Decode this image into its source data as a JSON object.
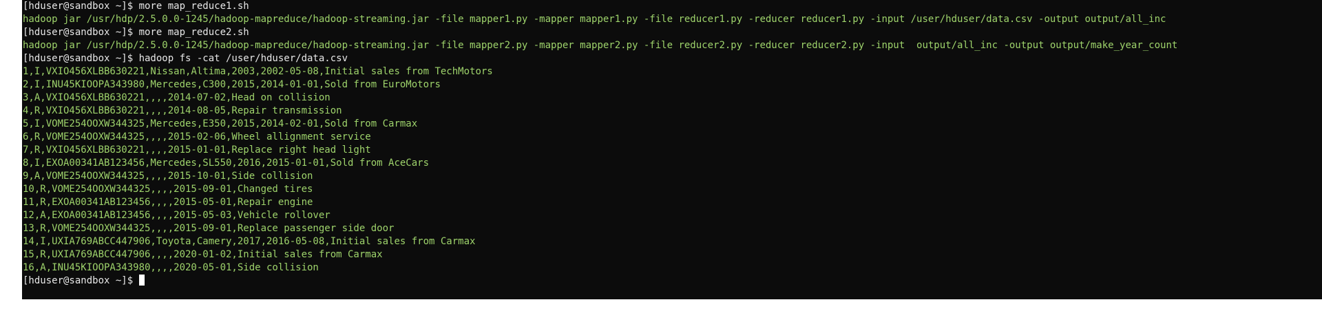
{
  "terminal": {
    "prompt_color": "#e8e8e8",
    "output_color": "#9ed36b",
    "background": "#0c0c0c",
    "lines": [
      {
        "type": "prompt",
        "text": "[hduser@sandbox ~]$ more map_reduce1.sh"
      },
      {
        "type": "output",
        "text": "hadoop jar /usr/hdp/2.5.0.0-1245/hadoop-mapreduce/hadoop-streaming.jar -file mapper1.py -mapper mapper1.py -file reducer1.py -reducer reducer1.py -input /user/hduser/data.csv -output output/all_inc"
      },
      {
        "type": "prompt",
        "text": "[hduser@sandbox ~]$ more map_reduce2.sh"
      },
      {
        "type": "output",
        "text": "hadoop jar /usr/hdp/2.5.0.0-1245/hadoop-mapreduce/hadoop-streaming.jar -file mapper2.py -mapper mapper2.py -file reducer2.py -reducer reducer2.py -input  output/all_inc -output output/make_year_count"
      },
      {
        "type": "prompt",
        "text": "[hduser@sandbox ~]$ hadoop fs -cat /user/hduser/data.csv"
      },
      {
        "type": "output",
        "text": "1,I,VXIO456XLBB630221,Nissan,Altima,2003,2002-05-08,Initial sales from TechMotors"
      },
      {
        "type": "output",
        "text": "2,I,INU45KIOOPA343980,Mercedes,C300,2015,2014-01-01,Sold from EuroMotors"
      },
      {
        "type": "output",
        "text": "3,A,VXIO456XLBB630221,,,,2014-07-02,Head on collision"
      },
      {
        "type": "output",
        "text": "4,R,VXIO456XLBB630221,,,,2014-08-05,Repair transmission"
      },
      {
        "type": "output",
        "text": "5,I,VOME254OOXW344325,Mercedes,E350,2015,2014-02-01,Sold from Carmax"
      },
      {
        "type": "output",
        "text": "6,R,VOME254OOXW344325,,,,2015-02-06,Wheel allignment service"
      },
      {
        "type": "output",
        "text": "7,R,VXIO456XLBB630221,,,,2015-01-01,Replace right head light"
      },
      {
        "type": "output",
        "text": "8,I,EXOA00341AB123456,Mercedes,SL550,2016,2015-01-01,Sold from AceCars"
      },
      {
        "type": "output",
        "text": "9,A,VOME254OOXW344325,,,,2015-10-01,Side collision"
      },
      {
        "type": "output",
        "text": "10,R,VOME254OOXW344325,,,,2015-09-01,Changed tires"
      },
      {
        "type": "output",
        "text": "11,R,EXOA00341AB123456,,,,2015-05-01,Repair engine"
      },
      {
        "type": "output",
        "text": "12,A,EXOA00341AB123456,,,,2015-05-03,Vehicle rollover"
      },
      {
        "type": "output",
        "text": "13,R,VOME254OOXW344325,,,,2015-09-01,Replace passenger side door"
      },
      {
        "type": "output",
        "text": "14,I,UXIA769ABCC447906,Toyota,Camery,2017,2016-05-08,Initial sales from Carmax"
      },
      {
        "type": "output",
        "text": "15,R,UXIA769ABCC447906,,,,2020-01-02,Initial sales from Carmax"
      },
      {
        "type": "output",
        "text": "16,A,INU45KIOOPA343980,,,,2020-05-01,Side collision"
      },
      {
        "type": "prompt",
        "text": "[hduser@sandbox ~]$ "
      }
    ]
  }
}
